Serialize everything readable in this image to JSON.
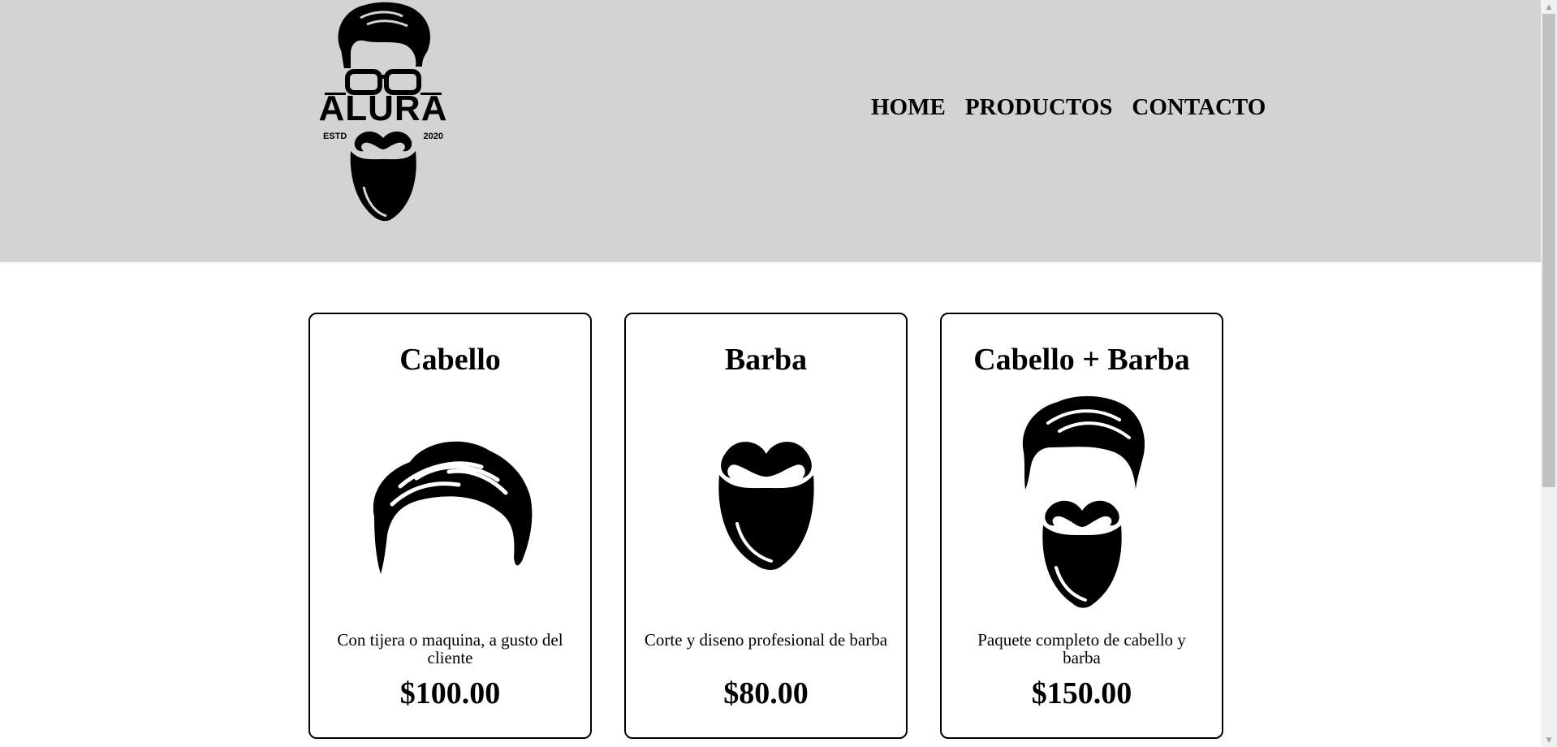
{
  "header": {
    "logo": {
      "brand": "ALURA",
      "estd": "ESTD",
      "year": "2020"
    },
    "nav": [
      "HOME",
      "PRODUCTOS",
      "CONTACTO"
    ]
  },
  "products": [
    {
      "title": "Cabello",
      "description": "Con tijera o maquina, a gusto del cliente",
      "price": "$100.00",
      "icon": "hair-icon"
    },
    {
      "title": "Barba",
      "description": "Corte y diseno profesional de barba",
      "price": "$80.00",
      "icon": "beard-icon"
    },
    {
      "title": "Cabello + Barba",
      "description": "Paquete completo de cabello y barba",
      "price": "$150.00",
      "icon": "hair-and-beard-icon"
    }
  ],
  "colors": {
    "header_bg": "#d3d3d3",
    "page_bg": "#ffffff",
    "text": "#000000"
  }
}
